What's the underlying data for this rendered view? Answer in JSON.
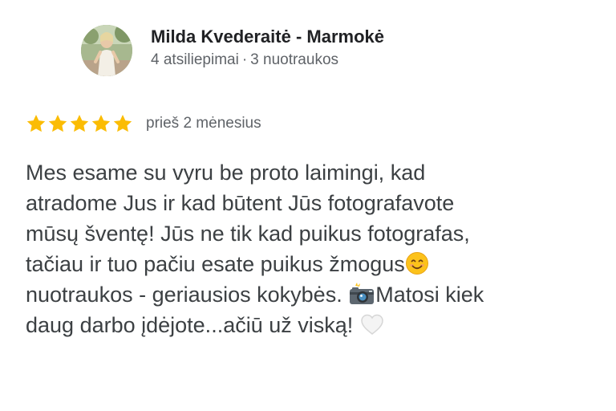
{
  "author": {
    "name": "Milda Kvederaitė - Marmokė",
    "reviews_count": "4 atsiliepimai",
    "separator": "·",
    "photos_count": "3 nuotraukos",
    "avatar_icon": "profile-photo"
  },
  "rating": {
    "stars": 5,
    "max": 5,
    "star_color": "#fbbc04",
    "date": "prieš 2 mėnesius"
  },
  "review": {
    "lines": [
      "Mes esame su vyru be proto laimingi, kad",
      "atradome Jus ir kad būtent Jūs fotografavote",
      "mūsų šventę! Jūs ne tik kad puikus fotografas,",
      "tačiau ir tuo pačiu esate puikus žmogus",
      "nuotraukos - geriausios kokybės. ",
      "Matosi kiek",
      "daug darbo įdėjote...ačiū už viską! "
    ],
    "emojis": [
      "smiling-face-emoji",
      "camera-with-flash-emoji",
      "white-heart-emoji"
    ]
  }
}
